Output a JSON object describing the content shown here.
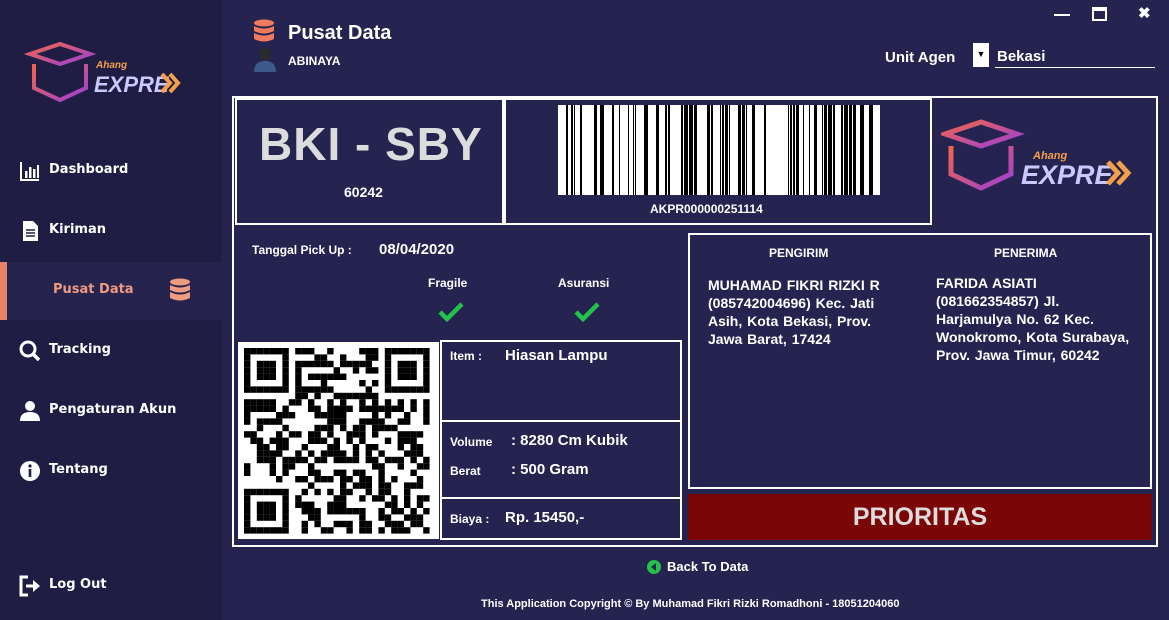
{
  "header": {
    "title": "Pusat Data",
    "user": "ABINAYA",
    "unit_label": "Unit Agen",
    "unit_value": "Bekasi"
  },
  "brand": {
    "small": "Ahang",
    "big": "EXPRESS"
  },
  "sidebar": {
    "items": [
      {
        "label": "Dashboard",
        "icon": "chart-icon"
      },
      {
        "label": "Kiriman",
        "icon": "document-icon"
      },
      {
        "label": "Pusat Data",
        "icon": "database-icon",
        "active": true
      },
      {
        "label": "Tracking",
        "icon": "search-icon"
      },
      {
        "label": "Pengaturan Akun",
        "icon": "user-icon"
      },
      {
        "label": "Tentang",
        "icon": "info-icon"
      },
      {
        "label": "Log Out",
        "icon": "logout-icon"
      }
    ]
  },
  "label": {
    "route": "BKI - SBY",
    "route_code": "60242",
    "tracking_number": "AKPR000000251114",
    "pickup_label": "Tanggal Pick Up :",
    "pickup_date": "08/04/2020",
    "fragile_label": "Fragile",
    "insurance_label": "Asuransi",
    "item_label": "Item :",
    "item_value": "Hiasan Lampu",
    "volume_label": "Volume",
    "volume_value": ":  8280 Cm Kubik",
    "weight_label": "Berat",
    "weight_value": ":  500 Gram",
    "cost_label": "Biaya :",
    "cost_value": "Rp. 15450,-",
    "sender_head": "PENGIRIM",
    "receiver_head": "PENERIMA",
    "sender": "MUHAMAD FIKRI RIZKI R (085742004696) Kec. Jati Asih, Kota Bekasi, Prov. Jawa Barat, 17424",
    "receiver": "FARIDA ASIATI (081662354857) Jl. Harjamulya No. 62 Kec. Wonokromo, Kota Surabaya, Prov. Jawa Timur, 60242",
    "service": "PRIORITAS"
  },
  "back_label": "Back To Data",
  "footer": "This Application Copyright © By Muhamad Fikri Rizki Romadhoni - 18051204060",
  "colors": {
    "accent": "#e8836b",
    "check": "#24c24a",
    "priority_bg": "#7a0605",
    "bg": "#25234f"
  }
}
